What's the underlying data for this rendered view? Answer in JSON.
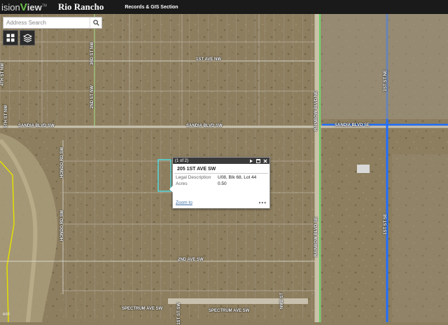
{
  "header": {
    "brand_prefix": "ision",
    "brand_v": "V",
    "brand_view": "iew",
    "brand_tm": "TM",
    "city": "Rio Rancho",
    "section": "Records & GIS Section"
  },
  "search": {
    "placeholder": "Address Search"
  },
  "popup": {
    "counter": "(1 of 2)",
    "title": "205 1ST AVE SW",
    "rows": [
      {
        "key": "Legal Description",
        "value": "U08, Blk 68, Lot 44"
      },
      {
        "key": "Acres",
        "value": "0.50"
      }
    ],
    "zoom_label": "Zoom to",
    "more": "•••"
  },
  "streets": {
    "first_ave_nw": "1ST AVE NW",
    "sandia_sw_left": "SANDIA BLVD SW",
    "sandia_sw_mid": "SANDIA BLVD SW",
    "sandia_se": "SANDIA BLVD SE",
    "second_ave_sw": "2ND AVE SW",
    "spectrum_left": "SPECTRUM AVE SW",
    "spectrum_right": "SPECTRUM AVE SW",
    "fourth_st_nw": "4TH ST NW",
    "fifth_st_nw": "5TH ST NW",
    "third_st_nw": "3RD ST NW",
    "second_st_nw": "2ND ST NW",
    "hondo_rd": "HONDO RD SW",
    "hondo_rd_2": "HONDO RD SW",
    "rainbow_ne": "RAINBOW BLVD NE",
    "rainbow_se": "RAINBOW BLVD SE",
    "first_st_ne": "1ST ST NE",
    "first_st_se": "1ST ST SE",
    "small_sw": "1ST ST SW",
    "nmb_st": "NMB ST"
  },
  "attribution": "esri"
}
